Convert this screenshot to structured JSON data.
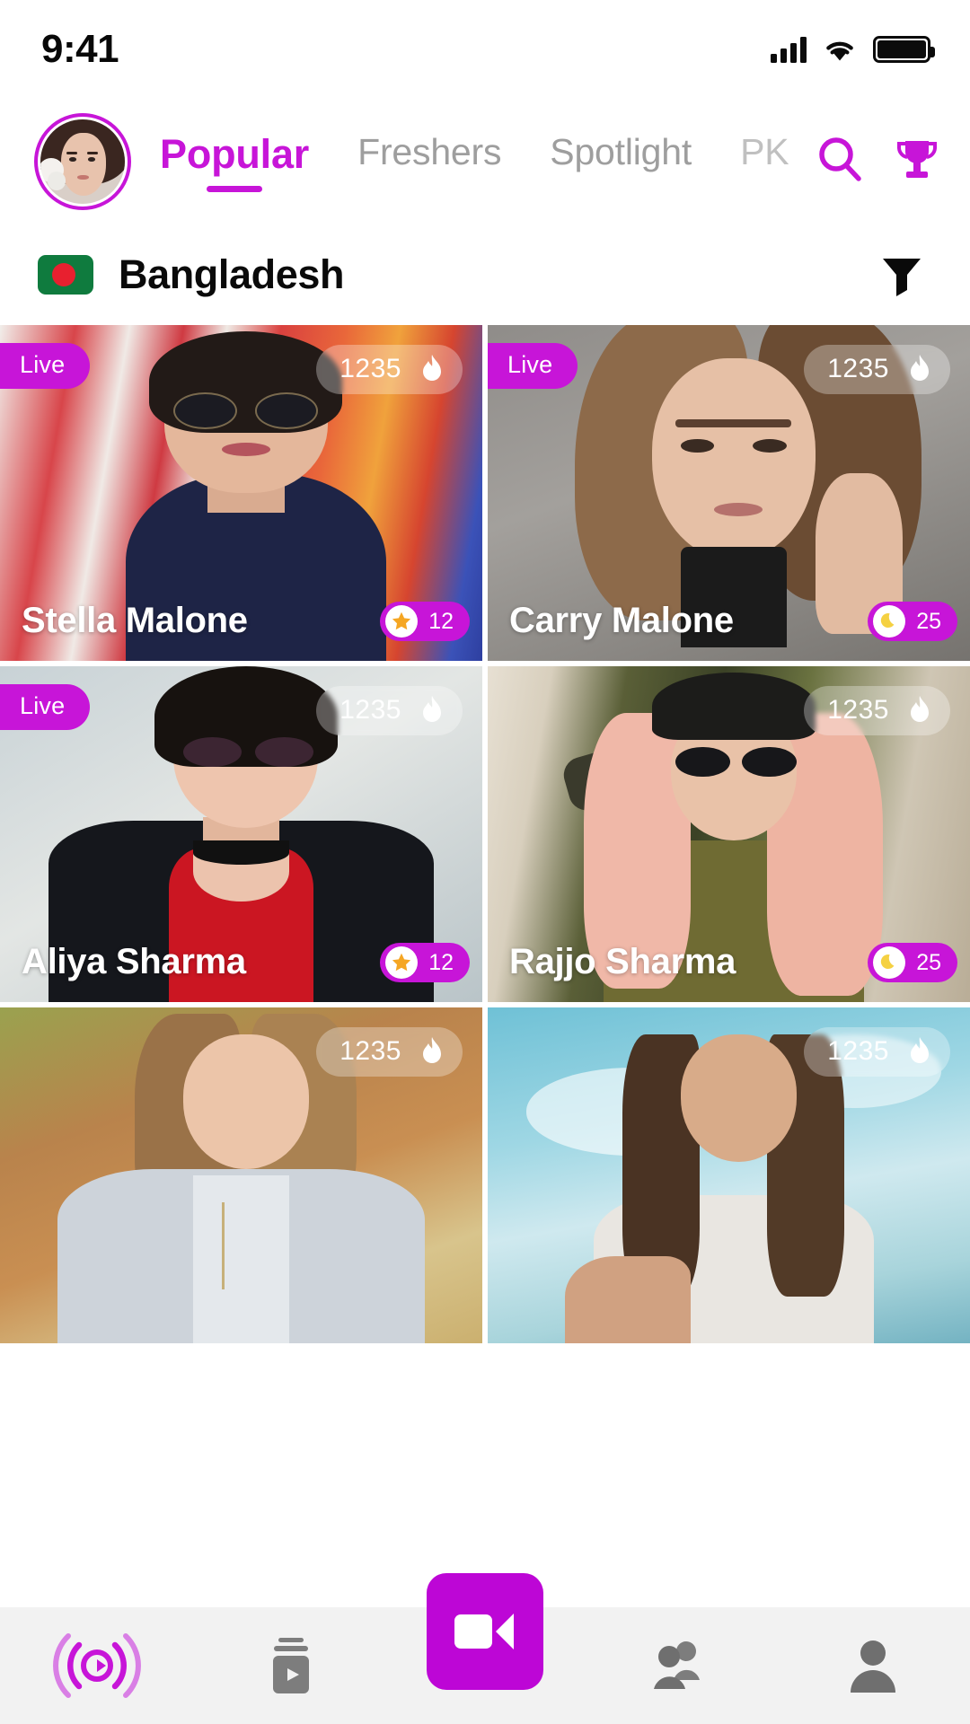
{
  "status_bar": {
    "time": "9:41",
    "signal_icon": "cellular-signal-icon",
    "wifi_icon": "wifi-icon",
    "battery_icon": "battery-full-icon"
  },
  "header": {
    "avatar_name": "profile-avatar",
    "tabs": [
      {
        "label": "Popular",
        "active": true
      },
      {
        "label": "Freshers",
        "active": false
      },
      {
        "label": "Spotlight",
        "active": false
      },
      {
        "label": "PK",
        "active": false
      }
    ],
    "search_icon": "search-icon",
    "trophy_icon": "trophy-icon"
  },
  "country_bar": {
    "flag": "bangladesh-flag-icon",
    "name": "Bangladesh",
    "filter_icon": "filter-funnel-icon"
  },
  "cards": [
    {
      "name": "Stella Malone",
      "live": true,
      "live_label": "Live",
      "viewers": "1235",
      "viewer_icon": "flame-icon",
      "gem_value": "12",
      "gem_icon": "star-icon"
    },
    {
      "name": "Carry Malone",
      "live": true,
      "live_label": "Live",
      "viewers": "1235",
      "viewer_icon": "flame-icon",
      "gem_value": "25",
      "gem_icon": "moon-icon"
    },
    {
      "name": "Aliya Sharma",
      "live": true,
      "live_label": "Live",
      "viewers": "1235",
      "viewer_icon": "flame-icon",
      "gem_value": "12",
      "gem_icon": "star-icon"
    },
    {
      "name": "Rajjo Sharma",
      "live": false,
      "live_label": "",
      "viewers": "1235",
      "viewer_icon": "flame-icon",
      "gem_value": "25",
      "gem_icon": "moon-icon"
    },
    {
      "name": "",
      "live": false,
      "live_label": "",
      "viewers": "1235",
      "viewer_icon": "flame-icon",
      "gem_value": "",
      "gem_icon": ""
    },
    {
      "name": "",
      "live": false,
      "live_label": "",
      "viewers": "1235",
      "viewer_icon": "flame-icon",
      "gem_value": "",
      "gem_icon": ""
    }
  ],
  "bottom_nav": {
    "items": [
      {
        "icon": "live-broadcast-icon",
        "active": true
      },
      {
        "icon": "reels-video-icon",
        "active": false
      },
      {
        "icon": "people-group-icon",
        "active": false
      },
      {
        "icon": "profile-person-icon",
        "active": false
      }
    ],
    "fab_icon": "video-camera-icon"
  },
  "colors": {
    "accent": "#c715d8",
    "fab": "#bd06d6",
    "inactive_tab": "#9e9e9e",
    "nav_bg": "#f2f2f2",
    "gem_star": "#f5a623",
    "gem_moon": "#f5d142"
  }
}
